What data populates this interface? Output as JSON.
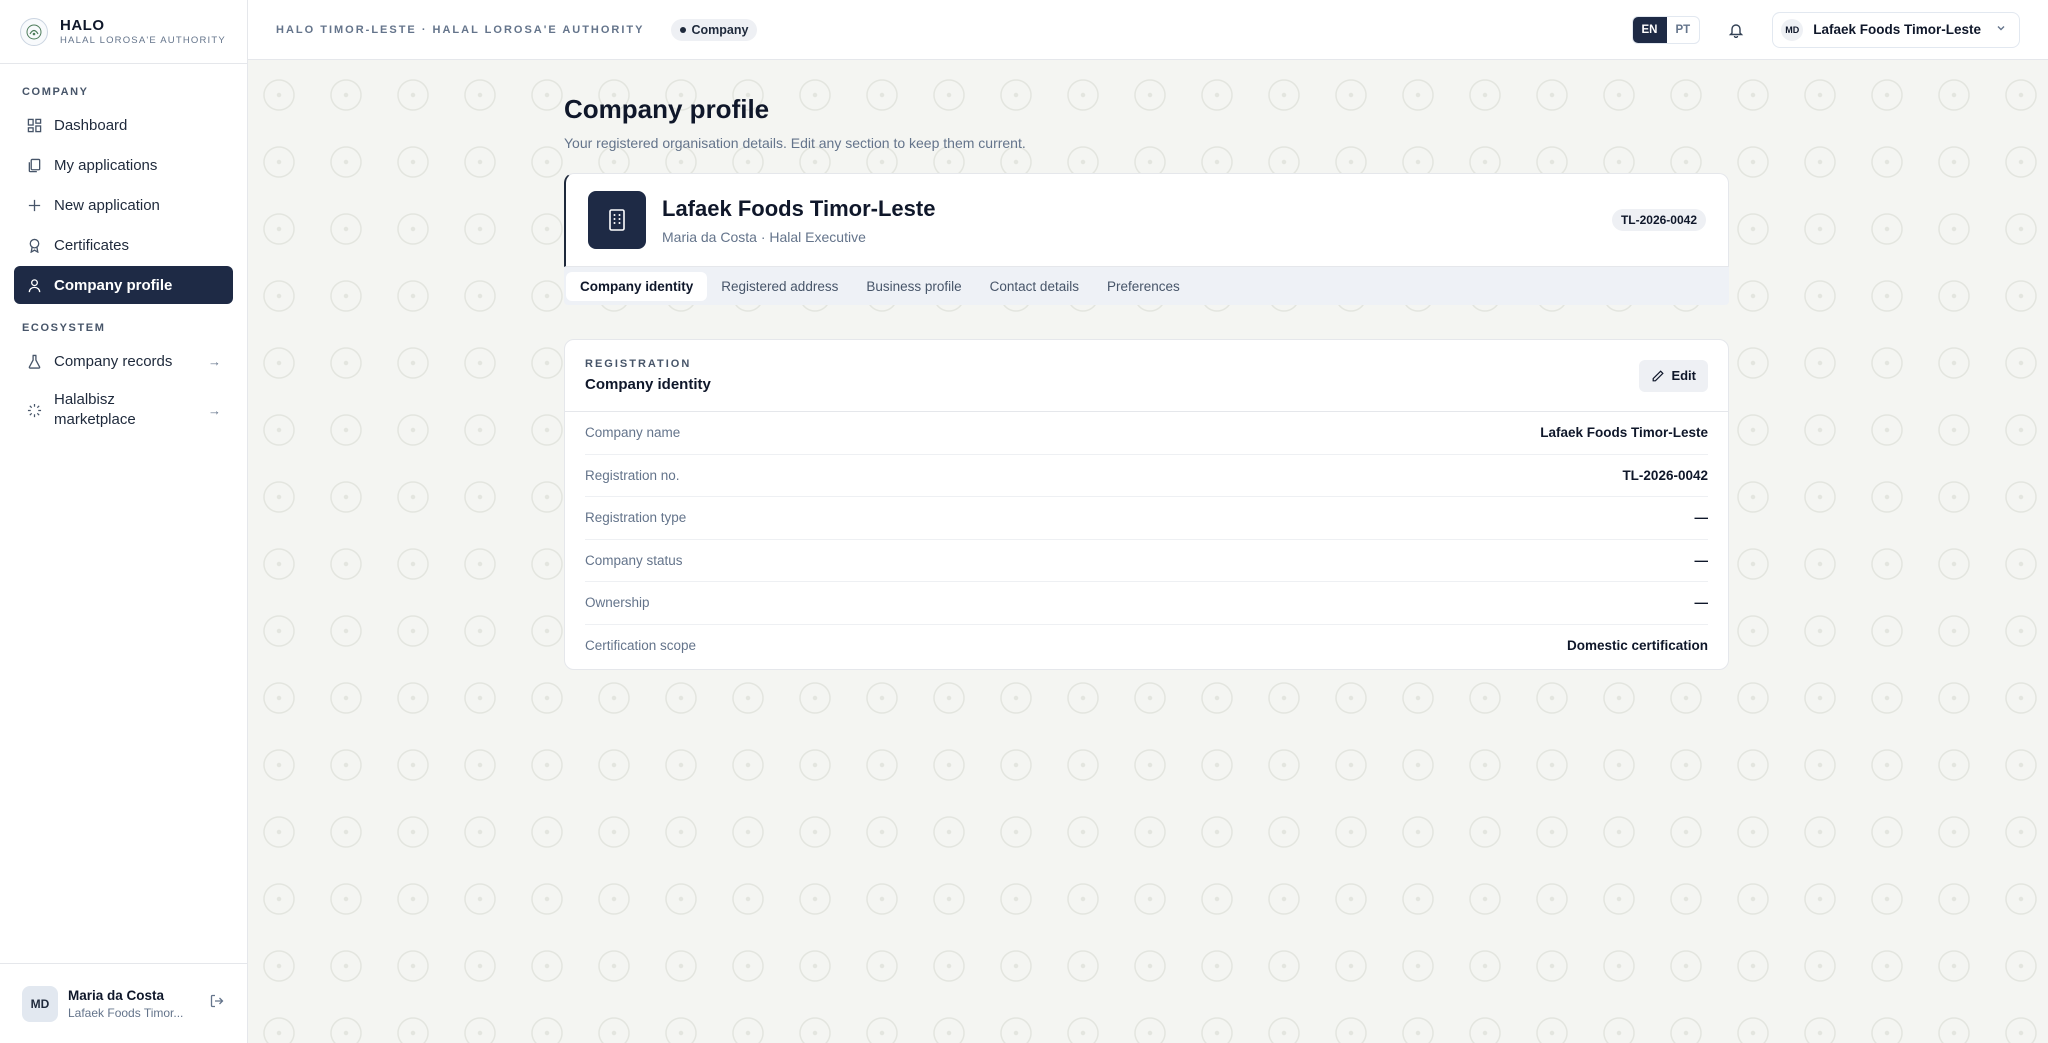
{
  "brand": {
    "title": "HALO",
    "subtitle": "HALAL LOROSA'E AUTHORITY"
  },
  "sidebar": {
    "company_label": "COMPANY",
    "company_items": [
      {
        "label": "Dashboard",
        "icon": "grid-icon"
      },
      {
        "label": "My applications",
        "icon": "copy-icon"
      },
      {
        "label": "New application",
        "icon": "plus-icon"
      },
      {
        "label": "Certificates",
        "icon": "award-icon"
      },
      {
        "label": "Company profile",
        "icon": "user-icon",
        "active": true
      }
    ],
    "ecosystem_label": "ECOSYSTEM",
    "ecosystem_items": [
      {
        "label": "Company records",
        "icon": "flask-icon"
      },
      {
        "label": "Halalbisz marketplace",
        "icon": "loader-icon"
      }
    ],
    "user": {
      "initials": "MD",
      "name": "Maria da Costa",
      "org": "Lafaek Foods Timor..."
    }
  },
  "topbar": {
    "breadcrumb": "HALO TIMOR-LESTE · HALAL LOROSA'E AUTHORITY",
    "context_pill": "Company",
    "lang_en": "EN",
    "lang_pt": "PT",
    "org_initials": "MD",
    "org_name": "Lafaek Foods Timor-Leste"
  },
  "main": {
    "title": "Company profile",
    "subtitle": "Your registered organisation details. Edit any section to keep them current.",
    "hero": {
      "name": "Lafaek Foods Timor-Leste",
      "meta": "Maria da Costa · Halal Executive",
      "reg_badge": "TL-2026-0042"
    },
    "tabs": [
      "Company identity",
      "Registered address",
      "Business profile",
      "Contact details",
      "Preferences"
    ],
    "card": {
      "kicker": "REGISTRATION",
      "title": "Company identity",
      "edit_label": "Edit",
      "rows": [
        {
          "k": "Company name",
          "v": "Lafaek Foods Timor-Leste"
        },
        {
          "k": "Registration no.",
          "v": "TL-2026-0042"
        },
        {
          "k": "Registration type",
          "v": "—"
        },
        {
          "k": "Company status",
          "v": "—"
        },
        {
          "k": "Ownership",
          "v": "—"
        },
        {
          "k": "Certification scope",
          "v": "Domestic certification"
        }
      ]
    }
  },
  "colors": {
    "accent": "#1e2a45",
    "background": "#f4f5f2"
  }
}
